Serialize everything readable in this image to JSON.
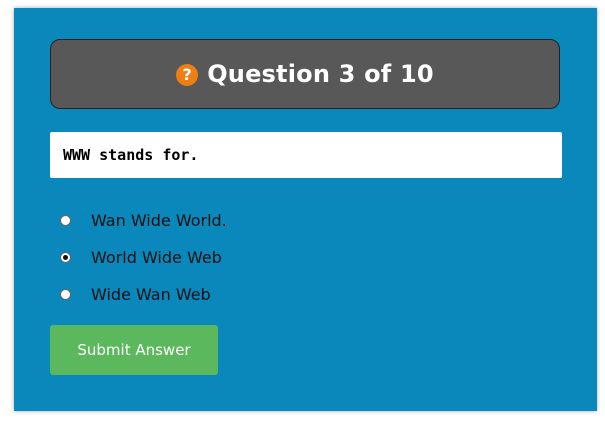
{
  "header": {
    "icon": "help-icon",
    "icon_glyph": "?",
    "icon_color": "#ee7e16",
    "title": "Question 3 of 10"
  },
  "question": {
    "text": "WWW stands for."
  },
  "options": [
    {
      "label": "Wan Wide World.",
      "selected": false
    },
    {
      "label": "World Wide Web",
      "selected": true
    },
    {
      "label": "Wide Wan Web",
      "selected": false
    }
  ],
  "submit": {
    "label": "Submit Answer"
  },
  "colors": {
    "panel_bg": "#0a87bb",
    "header_bg": "#585858",
    "button_bg": "#5cb85c"
  }
}
